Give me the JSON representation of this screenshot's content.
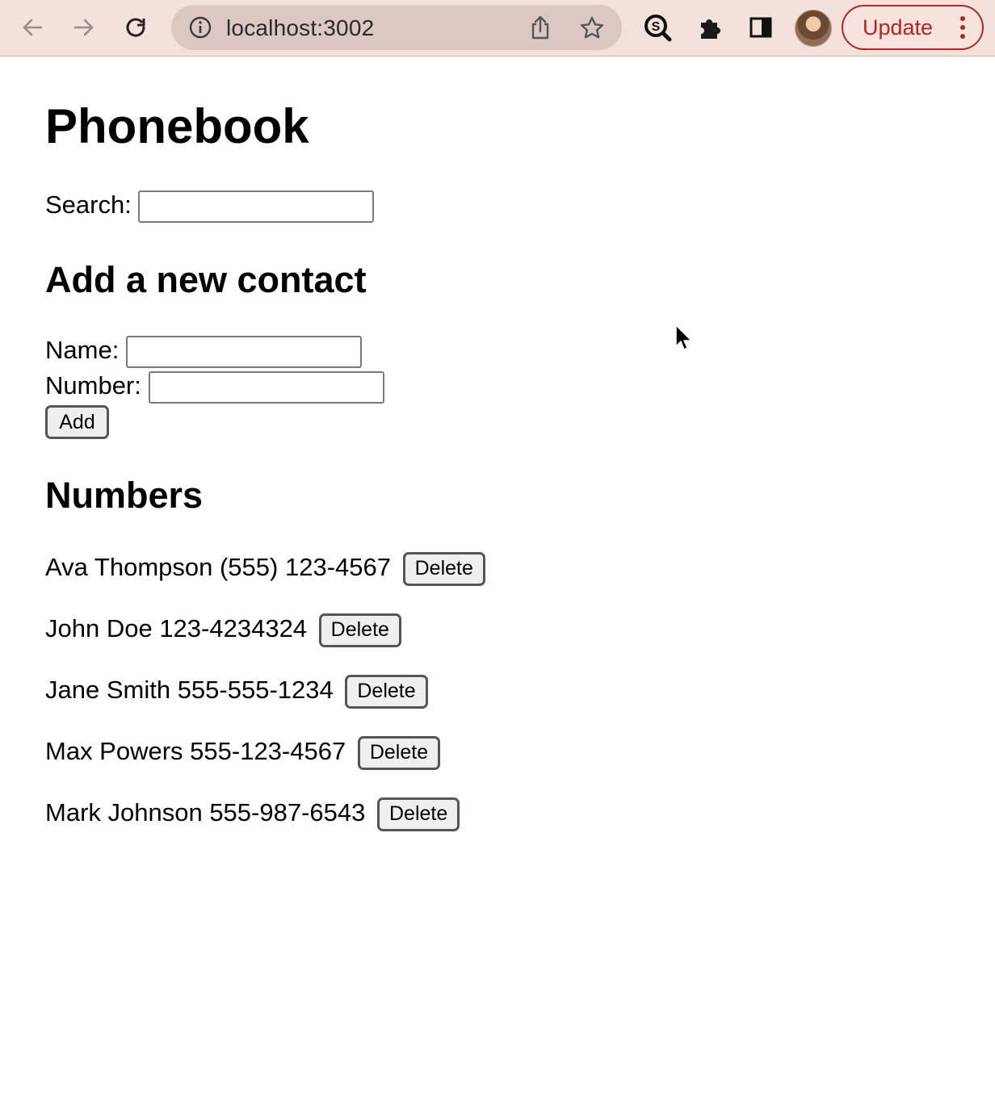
{
  "browser": {
    "url": "localhost:3002",
    "update_label": "Update",
    "icons": {
      "back": "arrow-left",
      "forward": "arrow-right",
      "reload": "reload",
      "site_info": "info-circle",
      "share": "share",
      "bookmark": "star",
      "extension_search": "search-extension",
      "extensions": "puzzle-piece",
      "side_panel": "side-panel",
      "profile": "avatar",
      "menu": "three-dots-vertical"
    },
    "toolbar_color": "#f5e1dc",
    "update_color": "#b3261e"
  },
  "page": {
    "title": "Phonebook",
    "search": {
      "label": "Search:",
      "value": ""
    },
    "add_section": {
      "heading": "Add a new contact",
      "name_label": "Name:",
      "name_value": "",
      "number_label": "Number:",
      "number_value": "",
      "add_button": "Add"
    },
    "numbers_heading": "Numbers",
    "contacts": [
      {
        "text": "Ava Thompson (555) 123-4567",
        "delete_label": "Delete"
      },
      {
        "text": "John Doe 123-4234324",
        "delete_label": "Delete"
      },
      {
        "text": "Jane Smith 555-555-1234",
        "delete_label": "Delete"
      },
      {
        "text": "Max Powers 555-123-4567",
        "delete_label": "Delete"
      },
      {
        "text": "Mark Johnson 555-987-6543",
        "delete_label": "Delete"
      }
    ]
  }
}
